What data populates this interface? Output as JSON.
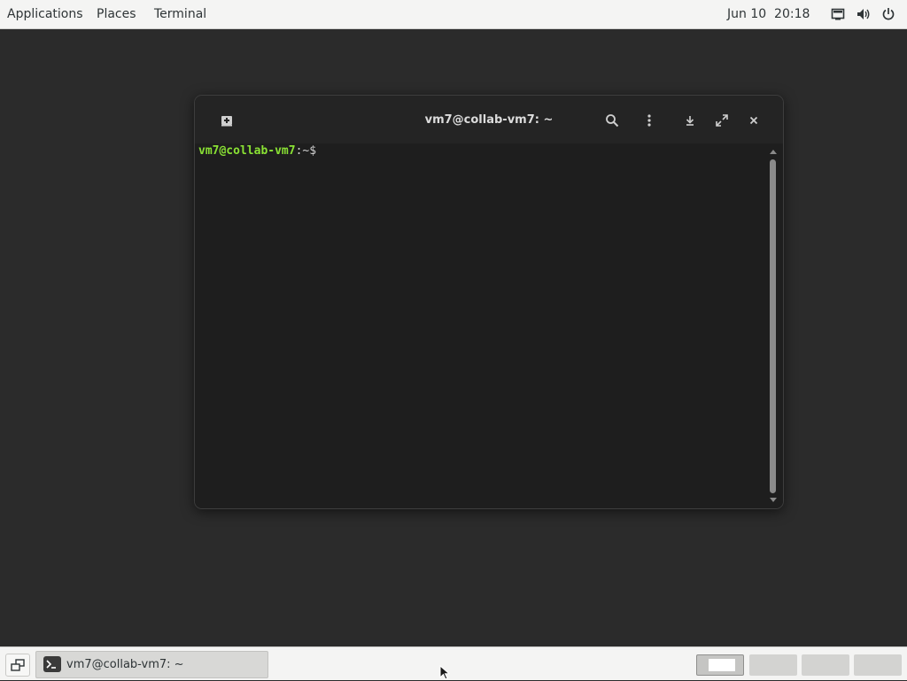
{
  "top_panel": {
    "menus": [
      "Applications",
      "Places",
      "Terminal"
    ],
    "clock": "Jun 10  20:18",
    "tray_icons": [
      "display-icon",
      "volume-icon",
      "power-icon"
    ]
  },
  "terminal": {
    "title": "vm7@collab-vm7: ~",
    "prompt_user": "vm7@collab-vm7",
    "prompt_path": ":~$",
    "header_icons": [
      "new-tab-icon",
      "search-icon",
      "menu-icon",
      "minimize-icon",
      "maximize-icon",
      "close-icon"
    ]
  },
  "taskbar": {
    "task_label": "vm7@collab-vm7: ~",
    "workspaces": 4,
    "active_workspace": 1
  },
  "colors": {
    "desktop_bg": "#2b2b2b",
    "panel_bg": "#f4f4f3",
    "terminal_bg": "#1e1e1e",
    "header_bg": "#242424",
    "prompt_user": "#8ae234"
  }
}
